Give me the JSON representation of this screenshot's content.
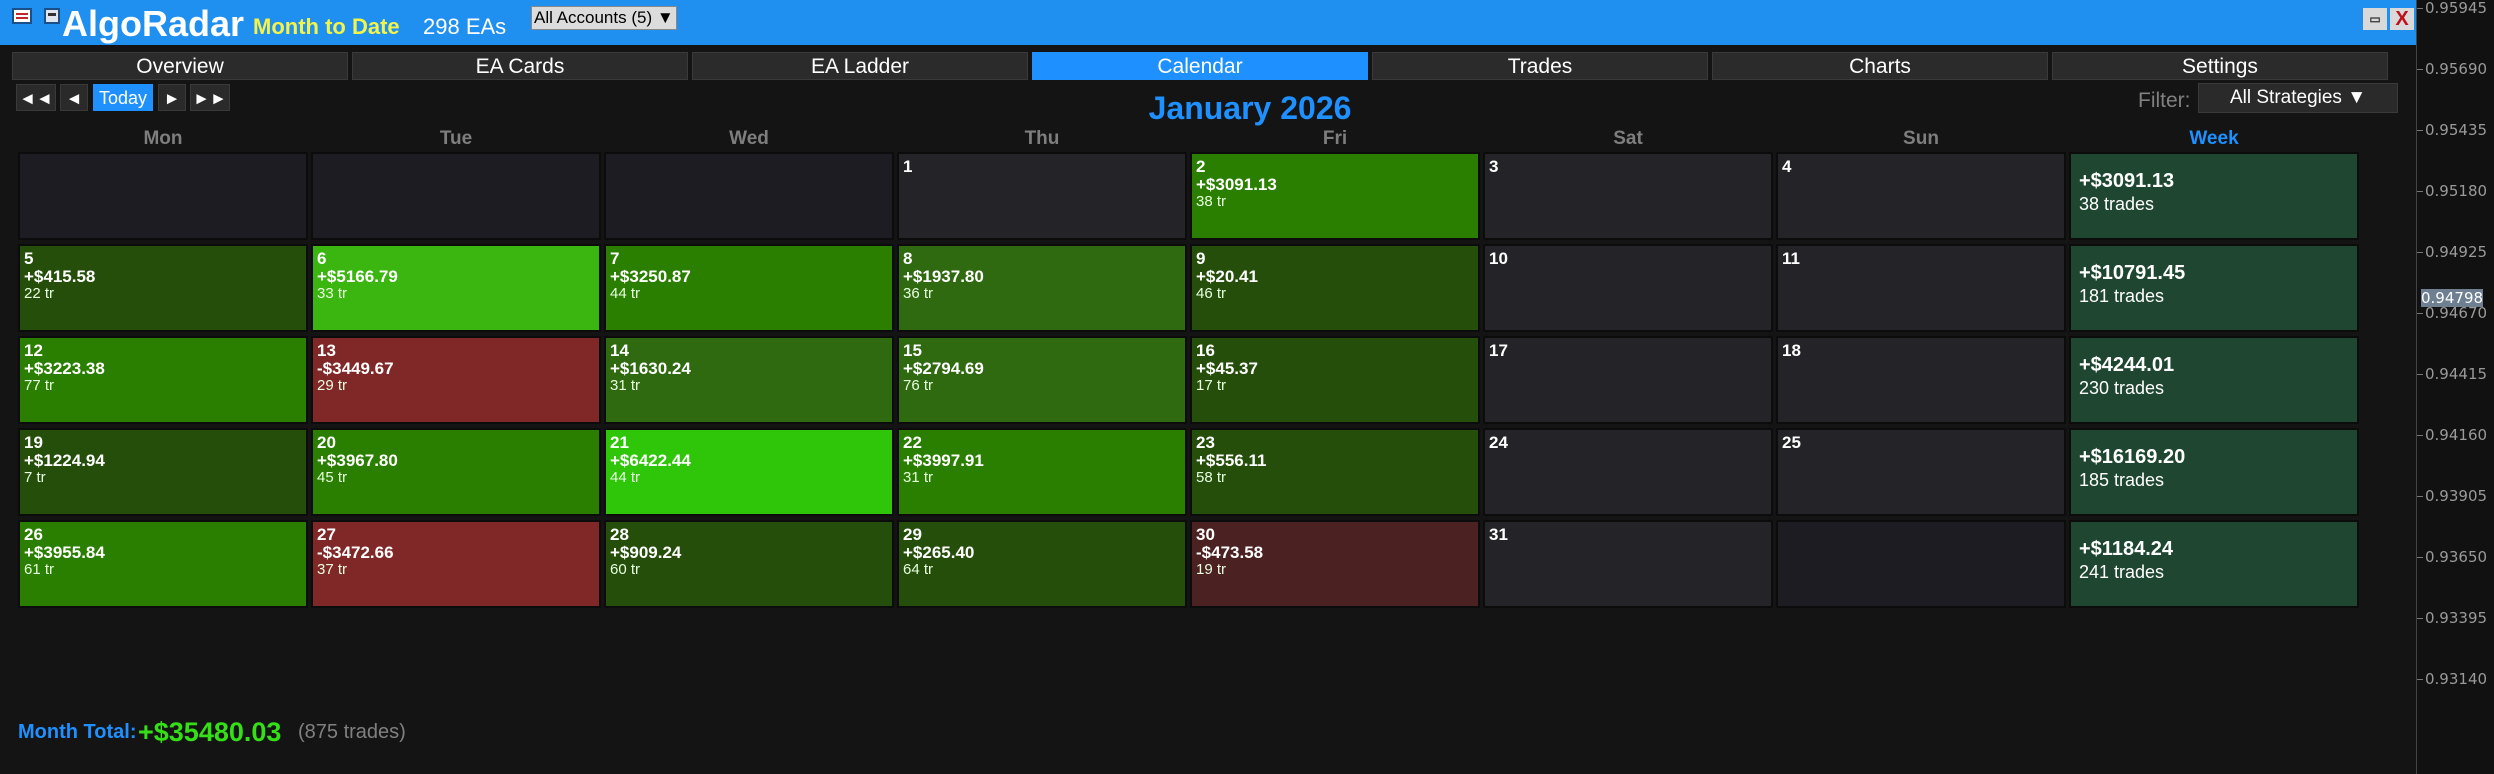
{
  "titlebar": {
    "app_name": "AlgoRadar",
    "period": "Month to Date",
    "ea_count": "298 EAs",
    "accounts_select": "All Accounts (5) ▼",
    "close_label": "X",
    "minimize_label": "▭"
  },
  "tabs": [
    {
      "label": "Overview",
      "active": false
    },
    {
      "label": "EA Cards",
      "active": false
    },
    {
      "label": "EA Ladder",
      "active": false
    },
    {
      "label": "Calendar",
      "active": true
    },
    {
      "label": "Trades",
      "active": false
    },
    {
      "label": "Charts",
      "active": false
    },
    {
      "label": "Settings",
      "active": false
    }
  ],
  "nav": {
    "first": "◄◄",
    "prev": "◄",
    "today": "Today",
    "next": "►",
    "last": "►►",
    "month_title": "January 2026",
    "filter_label": "Filter:",
    "filter_value": "All Strategies ▼"
  },
  "day_headers": [
    "Mon",
    "Tue",
    "Wed",
    "Thu",
    "Fri",
    "Sat",
    "Sun",
    "Week"
  ],
  "weeks": [
    {
      "days": [
        {
          "day": "",
          "pnl": "",
          "trades": "",
          "style": "empty"
        },
        {
          "day": "",
          "pnl": "",
          "trades": "",
          "style": "empty"
        },
        {
          "day": "",
          "pnl": "",
          "trades": "",
          "style": "empty"
        },
        {
          "day": "1",
          "pnl": "",
          "trades": "",
          "style": "blank"
        },
        {
          "day": "2",
          "pnl": "+$3091.13",
          "trades": "38 tr",
          "style": "g3"
        },
        {
          "day": "3",
          "pnl": "",
          "trades": "",
          "style": "blank"
        },
        {
          "day": "4",
          "pnl": "",
          "trades": "",
          "style": "blank"
        }
      ],
      "week_pnl": "+$3091.13",
      "week_trades": "38 trades"
    },
    {
      "days": [
        {
          "day": "5",
          "pnl": "+$415.58",
          "trades": "22 tr",
          "style": "g1"
        },
        {
          "day": "6",
          "pnl": "+$5166.79",
          "trades": "33 tr",
          "style": "g4"
        },
        {
          "day": "7",
          "pnl": "+$3250.87",
          "trades": "44 tr",
          "style": "g3"
        },
        {
          "day": "8",
          "pnl": "+$1937.80",
          "trades": "36 tr",
          "style": "g2"
        },
        {
          "day": "9",
          "pnl": "+$20.41",
          "trades": "46 tr",
          "style": "g1"
        },
        {
          "day": "10",
          "pnl": "",
          "trades": "",
          "style": "blank"
        },
        {
          "day": "11",
          "pnl": "",
          "trades": "",
          "style": "blank"
        }
      ],
      "week_pnl": "+$10791.45",
      "week_trades": "181 trades"
    },
    {
      "days": [
        {
          "day": "12",
          "pnl": "+$3223.38",
          "trades": "77 tr",
          "style": "g3"
        },
        {
          "day": "13",
          "pnl": "-$3449.67",
          "trades": "29 tr",
          "style": "r1"
        },
        {
          "day": "14",
          "pnl": "+$1630.24",
          "trades": "31 tr",
          "style": "g2"
        },
        {
          "day": "15",
          "pnl": "+$2794.69",
          "trades": "76 tr",
          "style": "g2"
        },
        {
          "day": "16",
          "pnl": "+$45.37",
          "trades": "17 tr",
          "style": "g1"
        },
        {
          "day": "17",
          "pnl": "",
          "trades": "",
          "style": "blank"
        },
        {
          "day": "18",
          "pnl": "",
          "trades": "",
          "style": "blank"
        }
      ],
      "week_pnl": "+$4244.01",
      "week_trades": "230 trades"
    },
    {
      "days": [
        {
          "day": "19",
          "pnl": "+$1224.94",
          "trades": "7 tr",
          "style": "g1"
        },
        {
          "day": "20",
          "pnl": "+$3967.80",
          "trades": "45 tr",
          "style": "g3"
        },
        {
          "day": "21",
          "pnl": "+$6422.44",
          "trades": "44 tr",
          "style": "g5"
        },
        {
          "day": "22",
          "pnl": "+$3997.91",
          "trades": "31 tr",
          "style": "g3"
        },
        {
          "day": "23",
          "pnl": "+$556.11",
          "trades": "58 tr",
          "style": "g1"
        },
        {
          "day": "24",
          "pnl": "",
          "trades": "",
          "style": "blank"
        },
        {
          "day": "25",
          "pnl": "",
          "trades": "",
          "style": "blank"
        }
      ],
      "week_pnl": "+$16169.20",
      "week_trades": "185 trades"
    },
    {
      "days": [
        {
          "day": "26",
          "pnl": "+$3955.84",
          "trades": "61 tr",
          "style": "g3"
        },
        {
          "day": "27",
          "pnl": "-$3472.66",
          "trades": "37 tr",
          "style": "r1"
        },
        {
          "day": "28",
          "pnl": "+$909.24",
          "trades": "60 tr",
          "style": "g1"
        },
        {
          "day": "29",
          "pnl": "+$265.40",
          "trades": "64 tr",
          "style": "g1"
        },
        {
          "day": "30",
          "pnl": "-$473.58",
          "trades": "19 tr",
          "style": "r2"
        },
        {
          "day": "31",
          "pnl": "",
          "trades": "",
          "style": "blank"
        },
        {
          "day": "",
          "pnl": "",
          "trades": "",
          "style": "empty"
        }
      ],
      "week_pnl": "+$1184.24",
      "week_trades": "241 trades"
    }
  ],
  "footer": {
    "month_total_label": "Month Total:",
    "month_total_value": "+$35480.03",
    "month_total_trades": "(875 trades)"
  },
  "price_scale": {
    "labels": [
      "0.95945",
      "0.95690",
      "0.95435",
      "0.95180",
      "0.94925",
      "0.94670",
      "0.94415",
      "0.94160",
      "0.93905",
      "0.93650",
      "0.93395",
      "0.93140"
    ],
    "current": "0.94798"
  },
  "colors": {
    "accent": "#1e90ff",
    "titlebar": "#1f8ff0",
    "period": "#f3f34a",
    "month_total": "#34e015",
    "loss": "#7f2827",
    "profit_strong": "#2fc60a",
    "week_cell": "#1e4630"
  }
}
